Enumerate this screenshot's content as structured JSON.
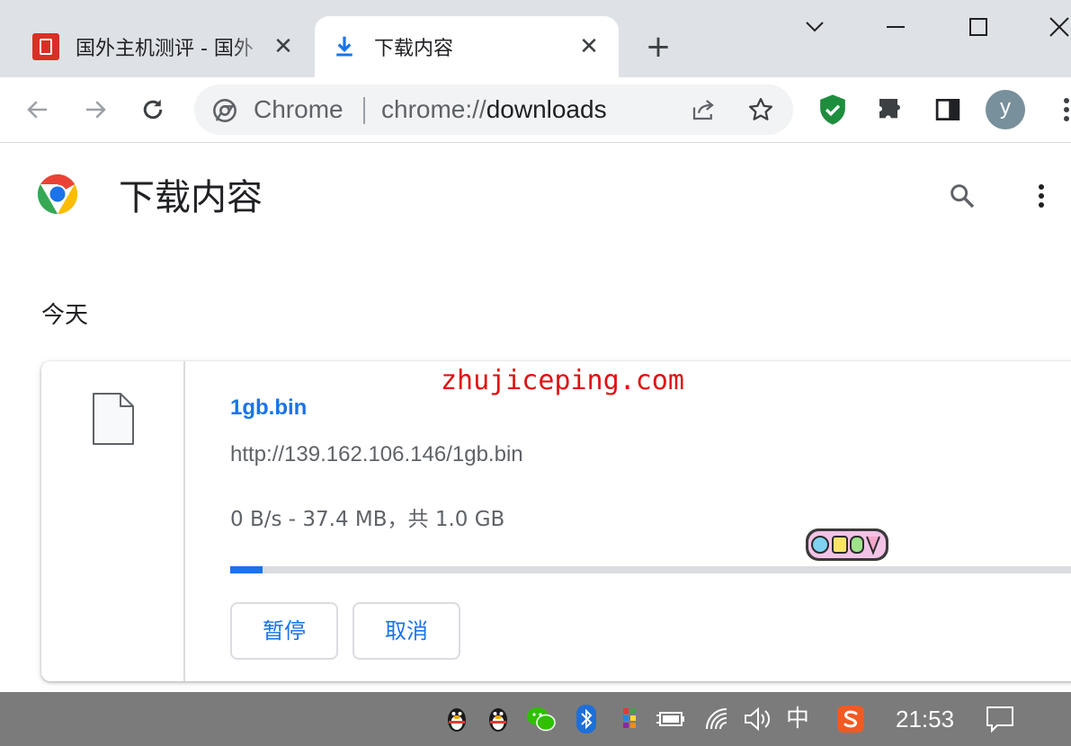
{
  "tabs": [
    {
      "title": "国外主机测评 - 国外",
      "favicon": "site-favicon-icon",
      "active": false
    },
    {
      "title": "下载内容",
      "favicon": "download-icon",
      "active": true
    }
  ],
  "window_controls": [
    "chevron-down-icon",
    "minimize-icon",
    "maximize-icon",
    "close-icon"
  ],
  "omnibox": {
    "chip": "Chrome",
    "url_scheme": "chrome://",
    "url_host": "downloads"
  },
  "avatar_letter": "y",
  "page": {
    "title": "下载内容",
    "date_heading": "今天"
  },
  "download": {
    "file_name": "1gb.bin",
    "url": "http://139.162.106.146/1gb.bin",
    "status": "0 B/s - 37.4 MB，共 1.0 GB",
    "progress": 0.0374,
    "pause_label": "暂停",
    "cancel_label": "取消"
  },
  "watermark": "zhujiceping.com",
  "sticker_text": "OZSV",
  "taskbar": {
    "ime": "中",
    "clock": "21:53"
  },
  "colors": {
    "accent": "#1a73e8",
    "tabstrip": "#dee1e6",
    "watermark": "#e01010",
    "shield": "#1e8e3e",
    "taskbar": "#7b7b7b"
  }
}
